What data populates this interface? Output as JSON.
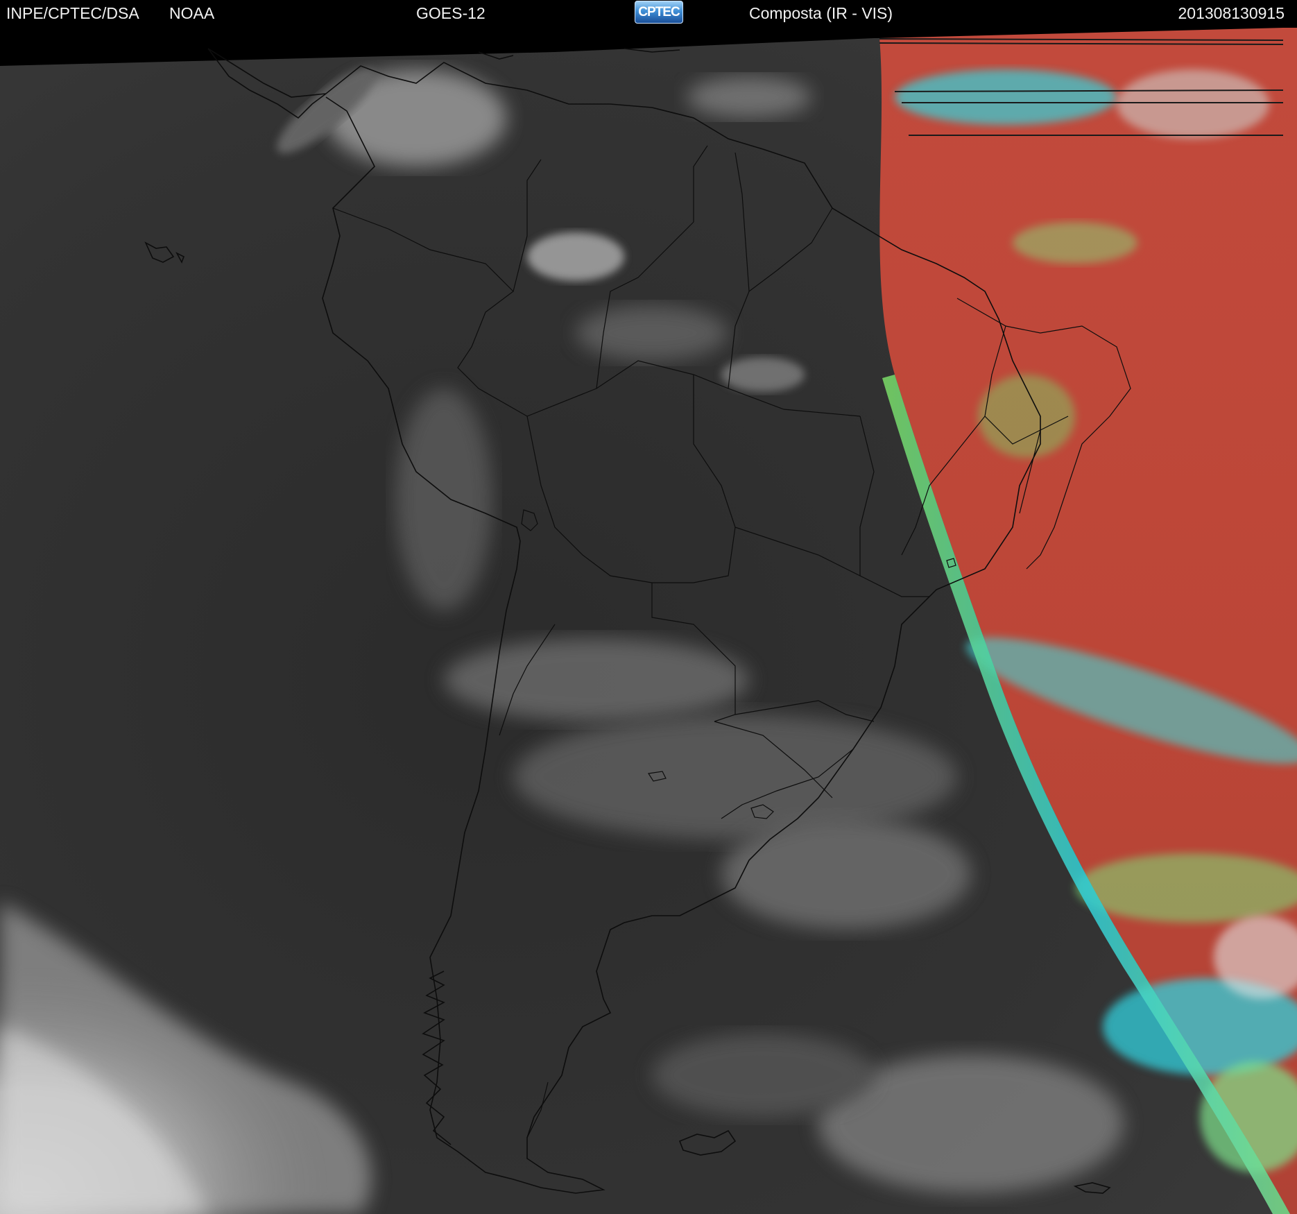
{
  "header": {
    "institution": "INPE/CPTEC/DSA",
    "agency": "NOAA",
    "satellite": "GOES-12",
    "logo_text": "CPTEC",
    "product": "Composta (IR - VIS)",
    "timestamp": "201308130915"
  },
  "map": {
    "region": "South America",
    "night_sector_colors": [
      "#2a2a2a",
      "#3a3a3a",
      "#9a9a9a"
    ],
    "day_sector_colors": [
      "#c0473a",
      "#b94436",
      "#7edc6a",
      "#34d2dc",
      "#e6e6e6"
    ],
    "outline_color": "#0d0d0d"
  }
}
